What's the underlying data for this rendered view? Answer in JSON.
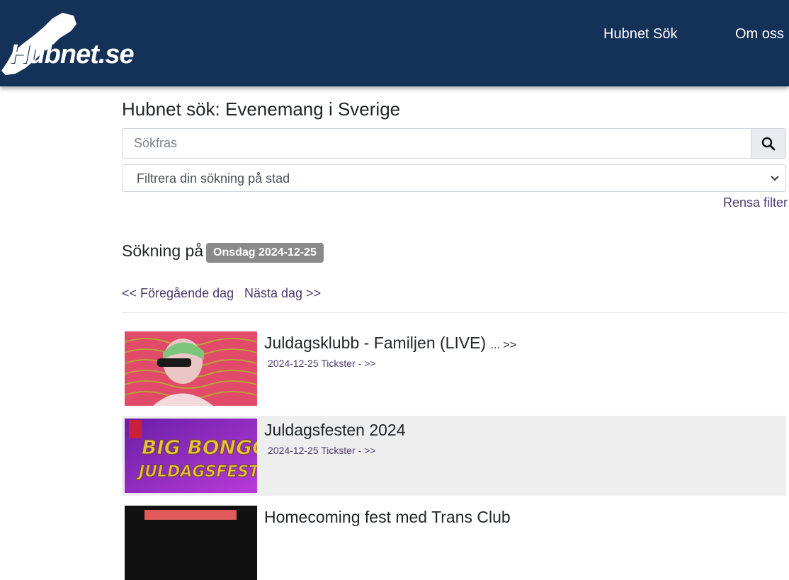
{
  "header": {
    "logo_text": "Hubnet.se",
    "nav": [
      {
        "label": "Hubnet Sök"
      },
      {
        "label": "Om oss"
      }
    ]
  },
  "page": {
    "title": "Hubnet sök: Evenemang i Sverige"
  },
  "search": {
    "placeholder": "Sökfras",
    "value": "",
    "button_icon": "search-icon"
  },
  "filter": {
    "city_select_value": "Filtrera din sökning på stad",
    "clear_label": "Rensa filter"
  },
  "date_section": {
    "label": "Sökning på",
    "date_badge": "Onsdag 2024-12-25",
    "prev_label": "<< Föregående dag",
    "next_label": "Nästa dag >>"
  },
  "events": [
    {
      "title": "Juldagsklubb - Familjen (LIVE)",
      "more": "... >>",
      "date": "2024-12-25",
      "tickets_label": "Tickster - >>"
    },
    {
      "title": "Juldagsfesten 2024",
      "more": "",
      "date": "2024-12-25",
      "tickets_label": "Tickster - >>"
    },
    {
      "title": "Homecoming fest med Trans Club",
      "more": "",
      "date": "",
      "tickets_label": ""
    }
  ],
  "colors": {
    "header_bg": "#143158",
    "link": "#4d3b6e",
    "badge_bg": "#8a8a8a",
    "alt_row_bg": "#eeeeee"
  }
}
